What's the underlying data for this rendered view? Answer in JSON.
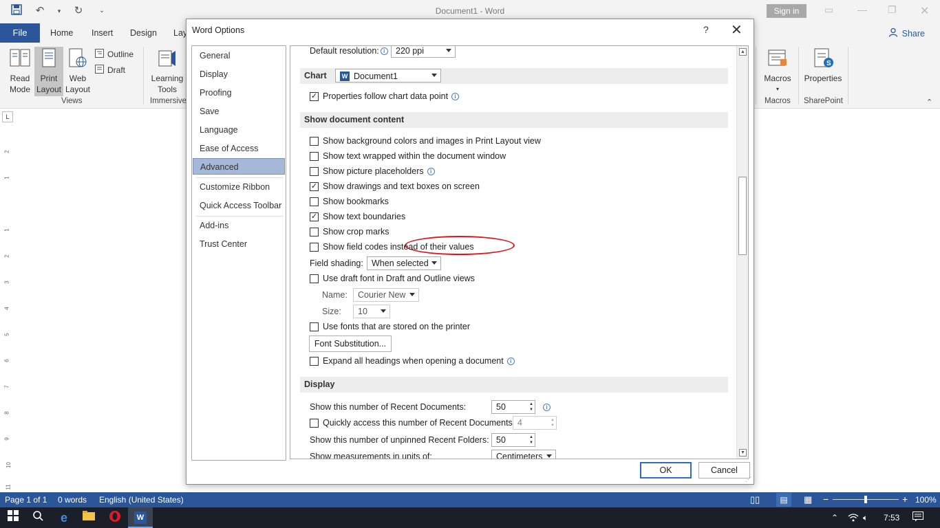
{
  "window": {
    "title": "Document1  -  Word",
    "sign_in": "Sign in"
  },
  "ribbon_tabs": {
    "file": "File",
    "home": "Home",
    "insert": "Insert",
    "design": "Design",
    "layout_partial": "Lay",
    "share": "Share"
  },
  "ribbon": {
    "read_mode": [
      "Read",
      "Mode"
    ],
    "print_layout": [
      "Print",
      "Layout"
    ],
    "web_layout": [
      "Web",
      "Layout"
    ],
    "outline": "Outline",
    "draft": "Draft",
    "views_group": "Views",
    "learning_tools": [
      "Learning",
      "Tools"
    ],
    "immersive_group": "Immersive",
    "macros": "Macros",
    "macros_group": "Macros",
    "properties": "Properties",
    "sharepoint_group": "SharePoint"
  },
  "ruler_numbers": [
    "2",
    "1",
    "1",
    "2",
    "3",
    "4",
    "5",
    "6",
    "7",
    "8",
    "9",
    "10",
    "11"
  ],
  "status": {
    "page": "Page 1 of 1",
    "words": "0 words",
    "language": "English (United States)",
    "zoom": "100%",
    "zoom_fraction": 0.5
  },
  "taskbar": {
    "time": "7:53"
  },
  "dialog": {
    "title": "Word Options",
    "help": "?",
    "nav": [
      {
        "label": "General"
      },
      {
        "label": "Display"
      },
      {
        "label": "Proofing"
      },
      {
        "label": "Save"
      },
      {
        "label": "Language"
      },
      {
        "label": "Ease of Access"
      },
      {
        "label": "Advanced",
        "selected": true
      },
      {
        "label": "Customize Ribbon"
      },
      {
        "label": "Quick Access Toolbar"
      },
      {
        "label": "Add-ins"
      },
      {
        "label": "Trust Center"
      }
    ],
    "default_resolution_label": "Default resolution:",
    "default_resolution_value": "220 ppi",
    "chart_section": "Chart",
    "chart_doc": "Document1",
    "properties_follow": "Properties follow chart data point",
    "show_doc_content_section": "Show document content",
    "options": [
      {
        "label": "Show background colors and images in Print Layout view",
        "checked": false
      },
      {
        "label": "Show text wrapped within the document window",
        "checked": false
      },
      {
        "label": "Show picture placeholders",
        "checked": false,
        "info": true
      },
      {
        "label": "Show drawings and text boxes on screen",
        "checked": true
      },
      {
        "label": "Show bookmarks",
        "checked": false
      },
      {
        "label": "Show text boundaries",
        "checked": true
      },
      {
        "label": "Show crop marks",
        "checked": false
      },
      {
        "label": "Show field codes instead of their values",
        "checked": false
      }
    ],
    "field_shading_label": "Field shading:",
    "field_shading_value": "When selected",
    "draft_font_label": "Use draft font in Draft and Outline views",
    "name_label": "Name:",
    "name_value": "Courier New",
    "size_label": "Size:",
    "size_value": "10",
    "printer_fonts_label": "Use fonts that are stored on the printer",
    "font_substitution": "Font Substitution...",
    "expand_headings": "Expand all headings when opening a document",
    "display_section": "Display",
    "recent_docs_label": "Show this number of Recent Documents:",
    "recent_docs_value": "50",
    "quick_access_label": "Quickly access this number of Recent Documents:",
    "quick_access_value": "4",
    "unpinned_folders_label": "Show this number of unpinned Recent Folders:",
    "unpinned_folders_value": "50",
    "measurements_label": "Show measurements in units of:",
    "measurements_value": "Centimeters",
    "ok": "OK",
    "cancel": "Cancel"
  }
}
